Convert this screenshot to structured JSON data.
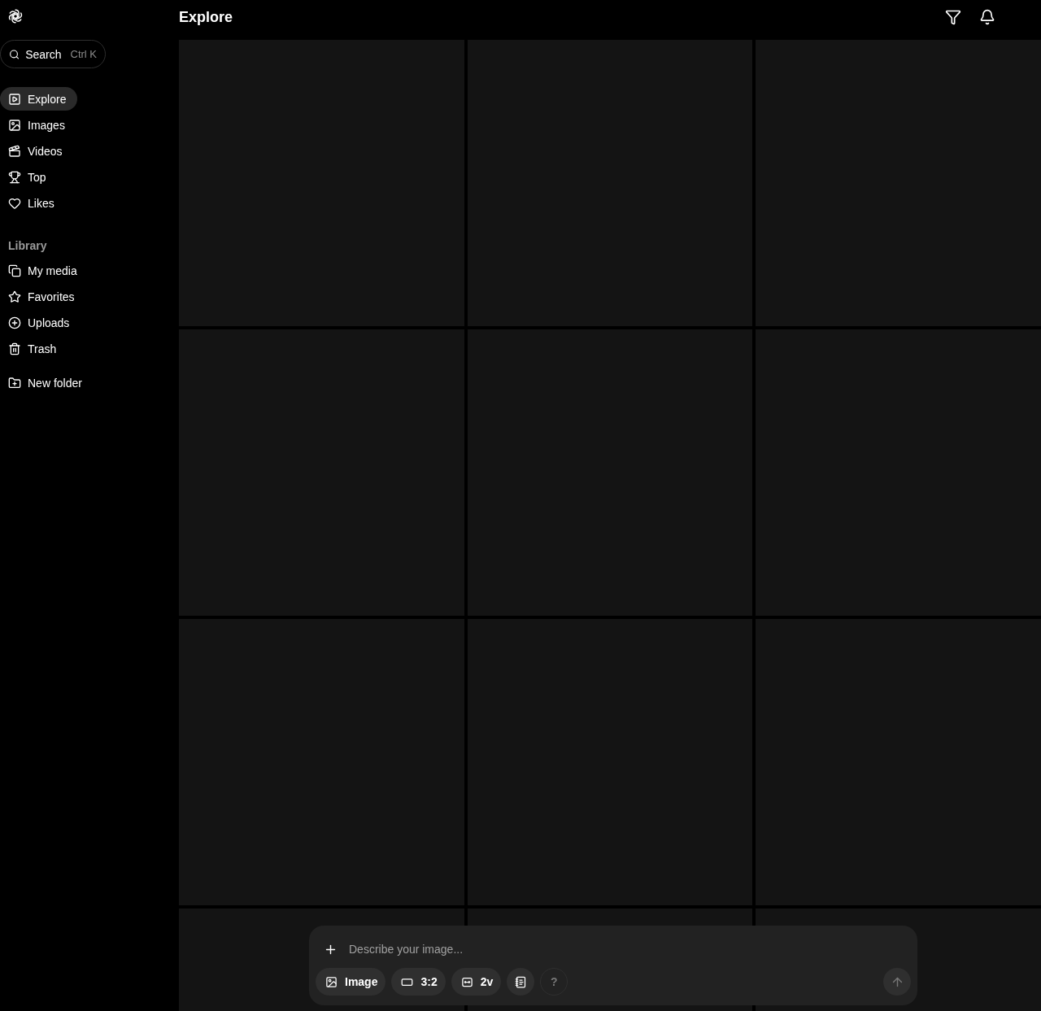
{
  "header": {
    "title": "Explore"
  },
  "search": {
    "label": "Search",
    "shortcut": "Ctrl K"
  },
  "nav": [
    {
      "label": "Explore",
      "selected": true
    },
    {
      "label": "Images",
      "selected": false
    },
    {
      "label": "Videos",
      "selected": false
    },
    {
      "label": "Top",
      "selected": false
    },
    {
      "label": "Likes",
      "selected": false
    }
  ],
  "library": {
    "heading": "Library",
    "items": [
      {
        "label": "My media",
        "selected": false
      },
      {
        "label": "Favorites",
        "selected": false
      },
      {
        "label": "Uploads",
        "selected": false
      },
      {
        "label": "Trash",
        "selected": false
      }
    ]
  },
  "new_folder": {
    "label": "New folder"
  },
  "tiles": [
    {
      "kind": "placeholder"
    },
    {
      "kind": "placeholder"
    },
    {
      "kind": "placeholder"
    },
    {
      "kind": "placeholder"
    },
    {
      "kind": "placeholder"
    },
    {
      "kind": "placeholder"
    },
    {
      "kind": "placeholder"
    },
    {
      "kind": "placeholder"
    },
    {
      "kind": "placeholder"
    },
    {
      "kind": "placeholder"
    },
    {
      "kind": "placeholder"
    },
    {
      "kind": "placeholder"
    }
  ],
  "prompt": {
    "placeholder": "Describe your image...",
    "chips": [
      {
        "kind": "mode",
        "label": "Image"
      },
      {
        "kind": "ratio",
        "label": "3:2"
      },
      {
        "kind": "variations",
        "label": "2v"
      },
      {
        "kind": "preset"
      },
      {
        "kind": "help",
        "label": "?"
      }
    ]
  }
}
